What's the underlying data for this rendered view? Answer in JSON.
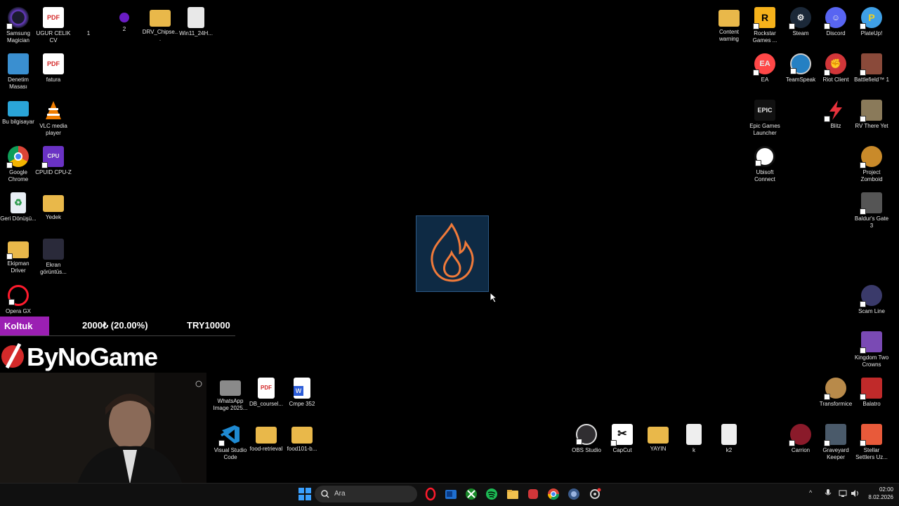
{
  "desktop": {
    "left_icons": [
      {
        "label": "Samsung Magician",
        "icon": "samsung-magician-icon",
        "color": "#5a2ea6"
      },
      {
        "label": "UGUR CELIK CV",
        "icon": "pdf-icon",
        "color": "#d42a2a"
      },
      {
        "label": "1",
        "icon": "blank-icon",
        "color": "#000000"
      },
      {
        "label": "2",
        "icon": "purple-app-icon",
        "color": "#6a1cc4"
      },
      {
        "label": "DRV_Chipse...",
        "icon": "folder-icon",
        "color": "#e9b84a"
      },
      {
        "label": "Win11_24H...",
        "icon": "disc-image-icon",
        "color": "#dddddd"
      },
      {
        "label": "Denetim Masası",
        "icon": "control-panel-icon",
        "color": "#3a8fd0"
      },
      {
        "label": "fatura",
        "icon": "pdf-icon",
        "color": "#d42a2a"
      },
      {
        "label": "Bu bilgisayar",
        "icon": "computer-icon",
        "color": "#2aa5d8"
      },
      {
        "label": "VLC media player",
        "icon": "vlc-icon",
        "color": "#f07d00"
      },
      {
        "label": "Google Chrome",
        "icon": "chrome-icon",
        "color": "#db4437"
      },
      {
        "label": "CPUID CPU-Z",
        "icon": "cpuz-icon",
        "color": "#6a32c4"
      },
      {
        "label": "Geri Dönüşü...",
        "icon": "recycle-bin-icon",
        "color": "#4ba3d8"
      },
      {
        "label": "Yedek",
        "icon": "folder-icon",
        "color": "#e9b84a"
      },
      {
        "label": "Ekipman Driver",
        "icon": "folder-icon",
        "color": "#e9b84a"
      },
      {
        "label": "Ekran görüntüs...",
        "icon": "screenshot-icon",
        "color": "#2a2a3a"
      },
      {
        "label": "Opera GX",
        "icon": "opera-gx-icon",
        "color": "#ff1b2d"
      }
    ],
    "mid_icons": [
      {
        "label": "WhatsApp Image 2025...",
        "icon": "image-file-icon",
        "color": "#999999"
      },
      {
        "label": "DB_coursel...",
        "icon": "pdf-icon",
        "color": "#d42a2a"
      },
      {
        "label": "Cmpe 352",
        "icon": "word-doc-icon",
        "color": "#2b5cd8"
      },
      {
        "label": "Visual Studio Code",
        "icon": "vscode-icon",
        "color": "#1f8ad2"
      },
      {
        "label": "food-retrieval",
        "icon": "folder-icon",
        "color": "#e9b84a"
      },
      {
        "label": "food101-b...",
        "icon": "folder-icon",
        "color": "#e9b84a"
      }
    ],
    "bottom_icons": [
      {
        "label": "OBS Studio",
        "icon": "obs-icon",
        "color": "#302e31"
      },
      {
        "label": "CapCut",
        "icon": "capcut-icon",
        "color": "#ffffff"
      },
      {
        "label": "YAYIN",
        "icon": "folder-icon",
        "color": "#e9b84a"
      },
      {
        "label": "k",
        "icon": "text-file-icon",
        "color": "#eeeeee"
      },
      {
        "label": "k2",
        "icon": "text-file-icon",
        "color": "#eeeeee"
      }
    ],
    "right_icons": [
      {
        "label": "Content warning",
        "icon": "folder-icon",
        "color": "#e9b84a"
      },
      {
        "label": "Rockstar Games ...",
        "icon": "rockstar-icon",
        "color": "#f6b21b"
      },
      {
        "label": "Steam",
        "icon": "steam-icon",
        "color": "#1b2838"
      },
      {
        "label": "Discord",
        "icon": "discord-icon",
        "color": "#5865f2"
      },
      {
        "label": "PlateUp!",
        "icon": "plateup-icon",
        "color": "#3fa0e6"
      },
      {
        "label": "EA",
        "icon": "ea-icon",
        "color": "#ff4747"
      },
      {
        "label": "TeamSpeak",
        "icon": "teamspeak-icon",
        "color": "#2580c3"
      },
      {
        "label": "Riot Client",
        "icon": "riot-icon",
        "color": "#d13639"
      },
      {
        "label": "Battlefield™ 1",
        "icon": "battlefield-icon",
        "color": "#8a4a3a"
      },
      {
        "label": "Epic Games Launcher",
        "icon": "epic-games-icon",
        "color": "#111111"
      },
      {
        "label": "Blitz",
        "icon": "blitz-icon",
        "color": "#e8323c"
      },
      {
        "label": "RV There Yet",
        "icon": "rv-there-yet-icon",
        "color": "#8a7a5a"
      },
      {
        "label": "Ubisoft Connect",
        "icon": "ubisoft-icon",
        "color": "#ffffff"
      },
      {
        "label": "Project Zomboid",
        "icon": "project-zomboid-icon",
        "color": "#c98a2a"
      },
      {
        "label": "Baldur's Gate 3",
        "icon": "baldurs-gate-icon",
        "color": "#555555"
      },
      {
        "label": "Scam Line",
        "icon": "scam-line-icon",
        "color": "#3a3a6a"
      },
      {
        "label": "Kingdom Two Crowns",
        "icon": "kingdom-icon",
        "color": "#7a4ab4"
      },
      {
        "label": "Transformice",
        "icon": "transformice-icon",
        "color": "#b88a4a"
      },
      {
        "label": "Balatro",
        "icon": "balatro-icon",
        "color": "#c02a2a"
      },
      {
        "label": "Carrion",
        "icon": "carrion-icon",
        "color": "#8a1a2a"
      },
      {
        "label": "Graveyard Keeper",
        "icon": "graveyard-keeper-icon",
        "color": "#4a5a6a"
      },
      {
        "label": "Stellar Settlers Uz...",
        "icon": "stellar-settlers-icon",
        "color": "#e85a3a"
      }
    ]
  },
  "overlay": {
    "koltuk": "Koltuk",
    "amount": "2000₺ (20.00%)",
    "target": "TRY10000",
    "brand": "ByNoGame",
    "progress_fraction": 0.2
  },
  "center_tile": {
    "icon": "flame-icon",
    "color": "#e85a1a"
  },
  "taskbar": {
    "search_placeholder": "Ara",
    "time": "02:00",
    "date": "8.02.2026",
    "apps": [
      "start-icon",
      "opera-gx-icon",
      "outlook-icon",
      "xbox-icon",
      "spotify-icon",
      "file-explorer-icon",
      "app-red-icon",
      "chrome-icon",
      "app-blue-icon",
      "settings-icon"
    ]
  }
}
